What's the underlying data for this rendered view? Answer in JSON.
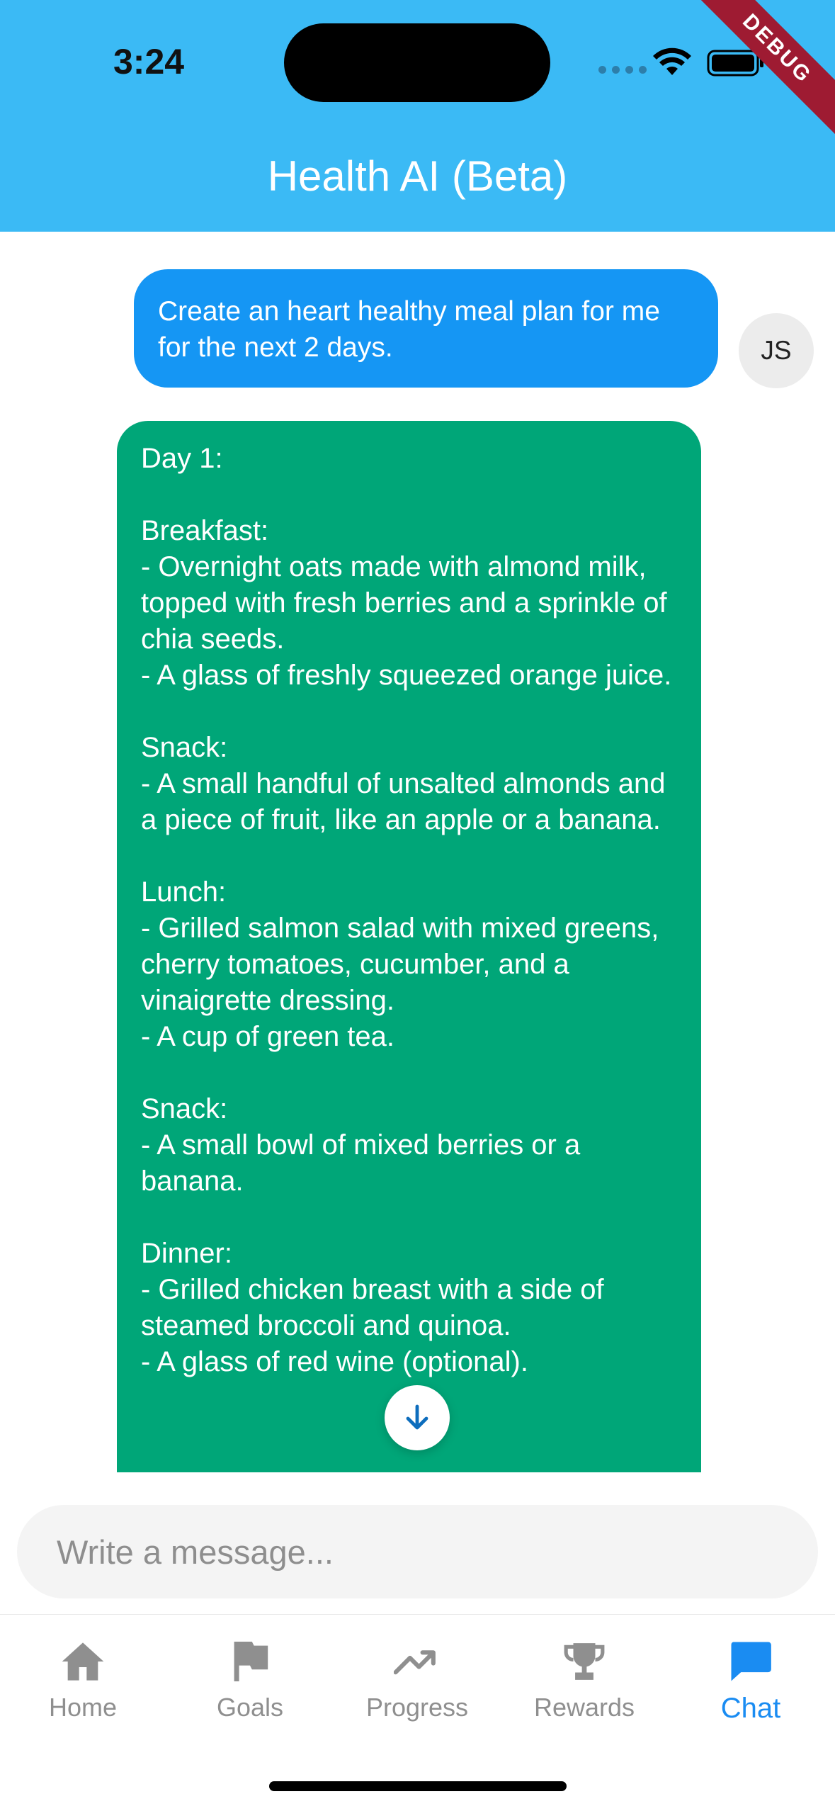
{
  "status_bar": {
    "time": "3:24",
    "debug_label": "DEBUG"
  },
  "app_bar": {
    "title": "Health AI (Beta)",
    "color": "#3bbaf5"
  },
  "messages": {
    "user": {
      "text": "Create an heart healthy meal plan for me for the next 2 days.",
      "avatar_initials": "JS"
    },
    "assistant": {
      "text": "Day 1:\n\nBreakfast:\n- Overnight oats made with almond milk, topped with fresh berries and a sprinkle of chia seeds.\n- A glass of freshly squeezed orange juice.\n\nSnack:\n- A small handful of unsalted almonds and a piece of fruit, like an apple or a banana.\n\nLunch:\n- Grilled salmon salad with mixed greens, cherry tomatoes, cucumber, and a vinaigrette dressing.\n- A cup of green tea.\n\nSnack:\n- A small bowl of mixed berries or a banana.\n\nDinner:\n- Grilled chicken breast with a side of steamed broccoli and quinoa.\n- A glass of red wine (optional)."
    }
  },
  "composer": {
    "placeholder": "Write a message..."
  },
  "bottom_nav": {
    "items": [
      {
        "label": "Home",
        "icon": "home-icon"
      },
      {
        "label": "Goals",
        "icon": "flag-icon"
      },
      {
        "label": "Progress",
        "icon": "trending-up-icon"
      },
      {
        "label": "Rewards",
        "icon": "trophy-icon"
      },
      {
        "label": "Chat",
        "icon": "chat-icon",
        "active": true
      }
    ]
  },
  "colors": {
    "user_bubble": "#1596f4",
    "assistant_bubble": "#00a678",
    "nav_active": "#1a8cf2",
    "nav_inactive": "#8f8f8f"
  }
}
